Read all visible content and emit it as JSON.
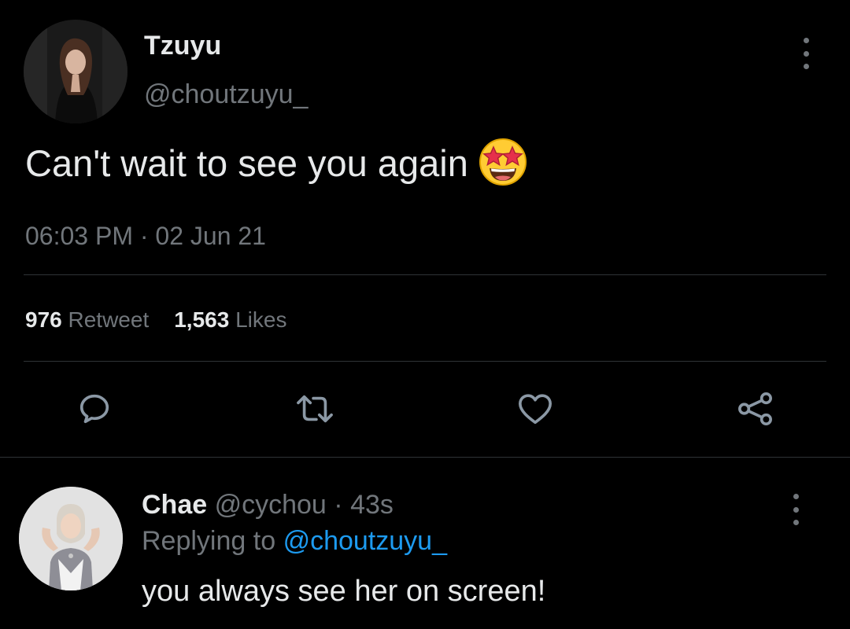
{
  "tweet": {
    "author": {
      "display_name": "Tzuyu",
      "handle": "@choutzuyu_"
    },
    "text": "Can't wait to see you again",
    "emoji": "star-struck-emoji",
    "timestamp": "06:03 PM · 02 Jun 21",
    "stats": {
      "retweets_count": "976",
      "retweets_label": "Retweet",
      "likes_count": "1,563",
      "likes_label": "Likes"
    },
    "actions": [
      "reply-icon",
      "retweet-icon",
      "like-icon",
      "share-icon"
    ]
  },
  "reply": {
    "author": {
      "display_name": "Chae",
      "handle": "@cychou",
      "time": "· 43s"
    },
    "replying_to_label": "Replying to",
    "replying_to_handle": "@choutzuyu_",
    "text": "you always see her on screen!"
  },
  "colors": {
    "background": "#000000",
    "primary_text": "#e7e9ea",
    "secondary_text": "#71767b",
    "accent": "#1d9bf0",
    "divider": "#2f3336"
  }
}
